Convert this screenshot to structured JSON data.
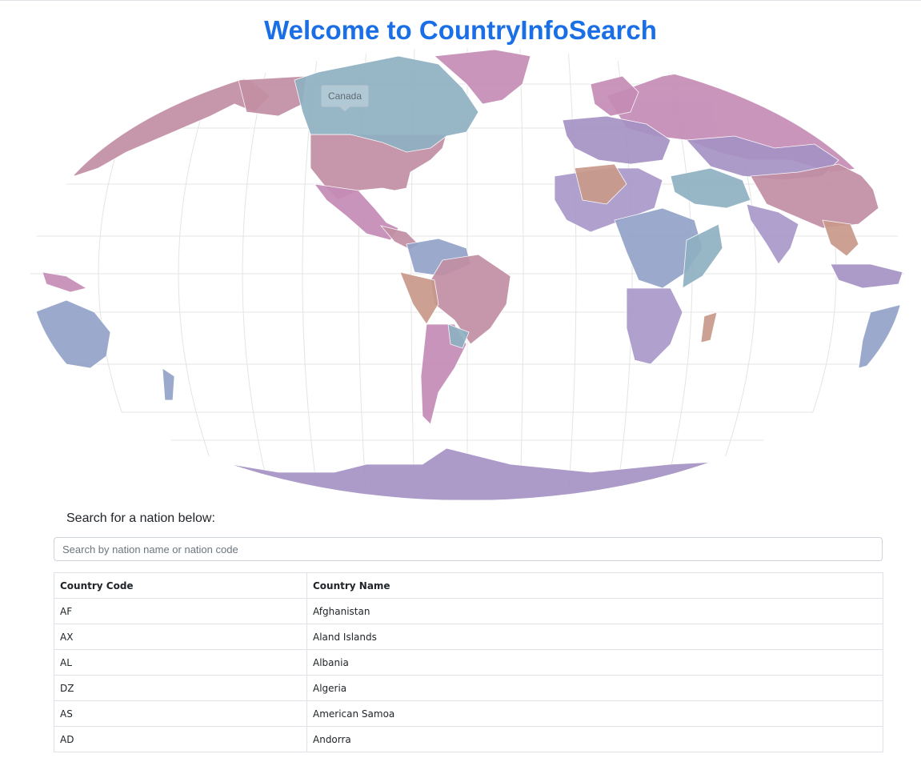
{
  "page": {
    "title": "Welcome to CountryInfoSearch"
  },
  "map": {
    "hover_label": "Canada",
    "palette": {
      "pink": "#c58cb6",
      "teal": "#8fb1c2",
      "blue": "#93a3c8",
      "purple": "#a592c4",
      "rose": "#c28fa3",
      "orange": "#c89a8a"
    }
  },
  "search": {
    "prompt": "Search for a nation below:",
    "placeholder": "Search by nation name or nation code",
    "value": ""
  },
  "table": {
    "headers": {
      "code": "Country Code",
      "name": "Country Name"
    },
    "rows": [
      {
        "code": "AF",
        "name": "Afghanistan"
      },
      {
        "code": "AX",
        "name": "Aland Islands"
      },
      {
        "code": "AL",
        "name": "Albania"
      },
      {
        "code": "DZ",
        "name": "Algeria"
      },
      {
        "code": "AS",
        "name": "American Samoa"
      },
      {
        "code": "AD",
        "name": "Andorra"
      }
    ]
  }
}
